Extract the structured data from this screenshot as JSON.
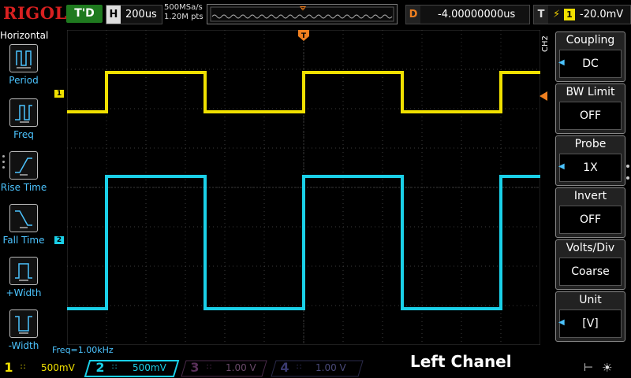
{
  "top": {
    "brand": "RIGOL",
    "trigger_status": "T'D",
    "h_label": "H",
    "timebase": "200us",
    "sample_rate": "500MSa/s",
    "memory_depth": "1.20M pts",
    "delay_label": "D",
    "delay": "-4.00000000us",
    "trigger_label": "T",
    "trigger_channel": "1",
    "trigger_level": "-20.0mV"
  },
  "left_panel": {
    "title": "Horizontal",
    "items": [
      {
        "label": "Period",
        "icon": "period-icon"
      },
      {
        "label": "Freq",
        "icon": "freq-icon"
      },
      {
        "label": "Rise Time",
        "icon": "rise-time-icon"
      },
      {
        "label": "Fall Time",
        "icon": "fall-time-icon"
      },
      {
        "label": "+Width",
        "icon": "positive-width-icon"
      },
      {
        "label": "-Width",
        "icon": "negative-width-icon"
      }
    ]
  },
  "right_menu": {
    "channel": "CH2",
    "items": [
      {
        "title": "Coupling",
        "value": "DC"
      },
      {
        "title": "BW Limit",
        "value": "OFF"
      },
      {
        "title": "Probe",
        "value": "1X"
      },
      {
        "title": "Invert",
        "value": "OFF"
      },
      {
        "title": "Volts/Div",
        "value": "Coarse"
      },
      {
        "title": "Unit",
        "value": "[V]"
      }
    ]
  },
  "measurement": "Freq=1.00kHz",
  "channels": [
    {
      "num": "1",
      "scale": "500mV",
      "color": "#f0e000",
      "active": true
    },
    {
      "num": "2",
      "scale": "500mV",
      "color": "#1ad0e8",
      "active": true
    },
    {
      "num": "3",
      "scale": "1.00 V",
      "color": "#c040c0",
      "active": false
    },
    {
      "num": "4",
      "scale": "1.00 V",
      "color": "#3060f0",
      "active": false
    }
  ],
  "markers": {
    "ch1": "1",
    "ch2": "2",
    "trigger_pos": "T"
  },
  "caption": "Left Chanel",
  "colors": {
    "ch1": "#f0e000",
    "ch2": "#1ad0e8",
    "trigger": "#f08020",
    "accent": "#4cc4ff"
  }
}
